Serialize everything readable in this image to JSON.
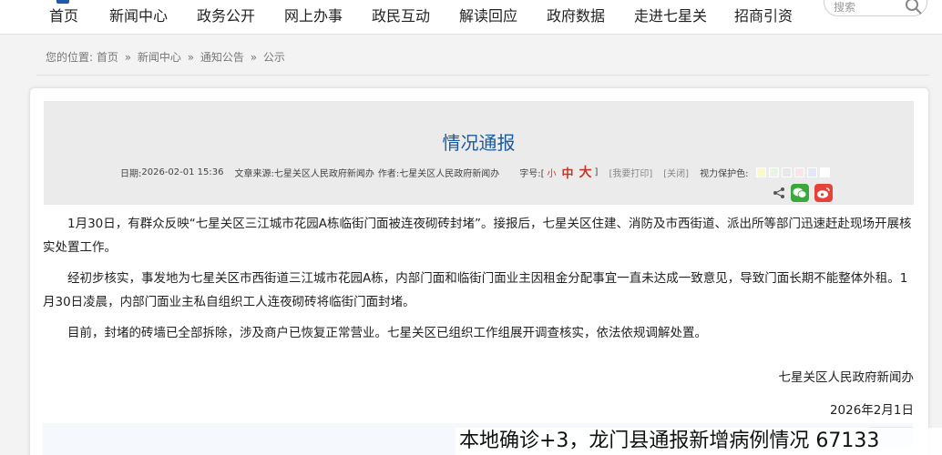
{
  "nav": {
    "items": [
      "首页",
      "新闻中心",
      "政务公开",
      "网上办事",
      "政民互动",
      "解读回应",
      "政府数据",
      "走进七星关",
      "招商引资"
    ]
  },
  "search": {
    "placeholder": "搜索"
  },
  "breadcrumb": {
    "prefix": "您的位置:",
    "items": [
      "首页",
      "新闻中心",
      "通知公告",
      "公示"
    ],
    "separator": "»"
  },
  "article": {
    "title": "情况通报",
    "meta": {
      "date_label": "日期:",
      "date": "2026-02-01 15:36",
      "source_label": "文章来源:",
      "source": "七星关区人民政府新闻办",
      "author_label": "作者:",
      "author": "七星关区人民政府新闻办",
      "fontsize_label": "字号:[",
      "fontsize_small": "小",
      "fontsize_mid": "中",
      "fontsize_big": "大",
      "fontsize_close": "]",
      "print": "[我要打印]",
      "close": "[关闭]",
      "eye_label": "视力保护色:",
      "eye_colors": [
        "#fafac8",
        "#e6f5e6",
        "#e8e8e8",
        "#fae6e6",
        "#e6e6fa",
        "#ffffff"
      ]
    },
    "paragraphs": [
      "1月30日，有群众反映“七星关区三江城市花园A栋临街门面被连夜砌砖封堵”。接报后，七星关区住建、消防及市西街道、派出所等部门迅速赶赴现场开展核实处置工作。",
      "经初步核实，事发地为七星关区市西街道三江城市花园A栋，内部门面和临街门面业主因租金分配事宜一直未达成一致意见，导致门面长期不能整体外租。1月30日凌晨，内部门面业主私自组织工人连夜砌砖将临街门面封堵。",
      "目前，封堵的砖墙已全部拆除，涉及商户已恢复正常营业。七星关区已组织工作组展开调查核实，依法依规调解处置。"
    ],
    "signature": "七星关区人民政府新闻办",
    "sign_date": "2026年2月1日"
  },
  "caption": "本地确诊+3，龙门县通报新增病例情况 67133",
  "colors": {
    "title": "#1b5a9c",
    "accent_red": "#c0392b",
    "wechat": "#3aa83a",
    "weibo": "#e6413a"
  }
}
